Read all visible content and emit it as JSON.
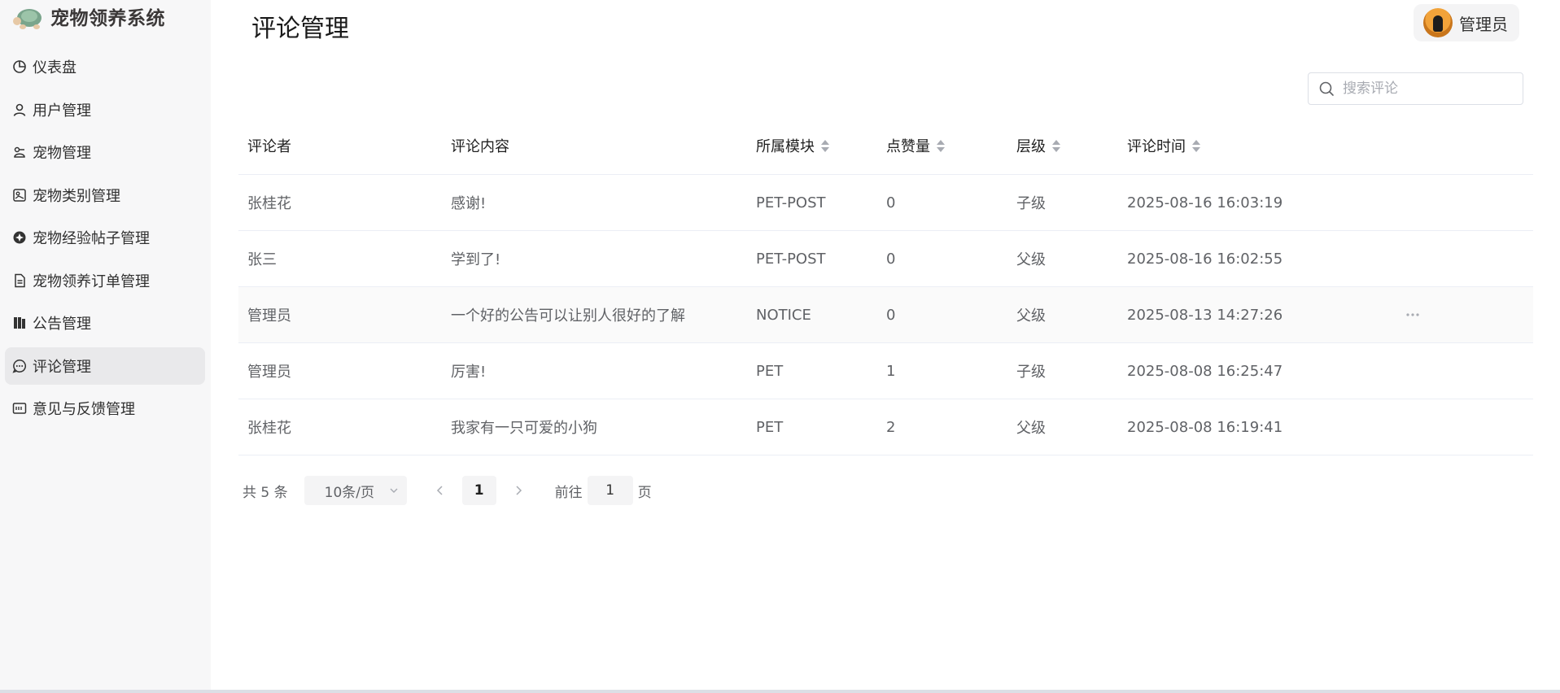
{
  "app": {
    "brand": "宠物领养系统"
  },
  "sidebar": {
    "items": [
      {
        "label": "仪表盘",
        "icon": "pie-chart-icon"
      },
      {
        "label": "用户管理",
        "icon": "user-icon"
      },
      {
        "label": "宠物管理",
        "icon": "pet-icon"
      },
      {
        "label": "宠物类别管理",
        "icon": "category-icon"
      },
      {
        "label": "宠物经验帖子管理",
        "icon": "post-icon"
      },
      {
        "label": "宠物领养订单管理",
        "icon": "document-icon"
      },
      {
        "label": "公告管理",
        "icon": "notice-icon"
      },
      {
        "label": "评论管理",
        "icon": "comment-icon",
        "active": true
      },
      {
        "label": "意见与反馈管理",
        "icon": "feedback-icon"
      }
    ]
  },
  "header": {
    "title": "评论管理",
    "user": "管理员"
  },
  "search": {
    "placeholder": "搜索评论",
    "value": ""
  },
  "table": {
    "columns": [
      "评论者",
      "评论内容",
      "所属模块",
      "点赞量",
      "层级",
      "评论时间"
    ],
    "rows": [
      {
        "author": "张桂花",
        "content": "感谢!",
        "module": "PET-POST",
        "likes": "0",
        "level": "子级",
        "time": "2025-08-16 16:03:19"
      },
      {
        "author": "张三",
        "content": "学到了!",
        "module": "PET-POST",
        "likes": "0",
        "level": "父级",
        "time": "2025-08-16 16:02:55"
      },
      {
        "author": "管理员",
        "content": "一个好的公告可以让别人很好的了解",
        "module": "NOTICE",
        "likes": "0",
        "level": "父级",
        "time": "2025-08-13 14:27:26"
      },
      {
        "author": "管理员",
        "content": "厉害!",
        "module": "PET",
        "likes": "1",
        "level": "子级",
        "time": "2025-08-08 16:25:47"
      },
      {
        "author": "张桂花",
        "content": "我家有一只可爱的小狗",
        "module": "PET",
        "likes": "2",
        "level": "父级",
        "time": "2025-08-08 16:19:41"
      }
    ]
  },
  "pagination": {
    "total": "共 5 条",
    "page_size": "10条/页",
    "current": "1",
    "jump_label": "前往",
    "jump_value": "1",
    "suffix": "页"
  }
}
